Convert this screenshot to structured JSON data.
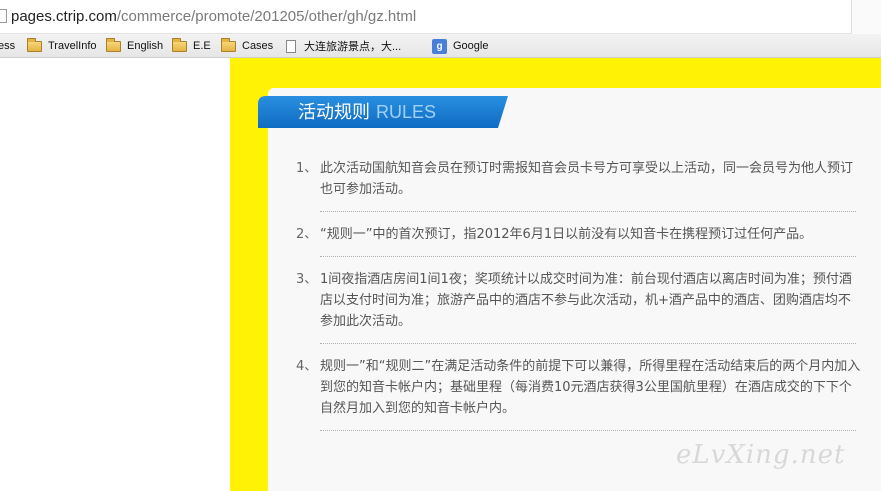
{
  "browser": {
    "url_host": "pages.ctrip.com",
    "url_path": "/commerce/promote/201205/other/gh/gz.html",
    "bookmarks": [
      {
        "label": "ess",
        "icon": "none"
      },
      {
        "label": "TravelInfo",
        "icon": "folder-icon"
      },
      {
        "label": "English",
        "icon": "folder-icon"
      },
      {
        "label": "E.E",
        "icon": "folder-icon"
      },
      {
        "label": "Cases",
        "icon": "folder-icon"
      },
      {
        "label": "大连旅游景点，大...",
        "icon": "page-icon"
      },
      {
        "label": "Google",
        "icon": "google-icon"
      }
    ],
    "google_letter": "g"
  },
  "colors": {
    "page_background": "#fff204",
    "panel": "#f8f8f8",
    "ribbon_blue": "#1379d1",
    "ribbon_light": "#9fd1f7"
  },
  "header": {
    "title_cn": "活动规则",
    "title_en": "RULES"
  },
  "rules": [
    {
      "num": "1、",
      "text": "此次活动国航知音会员在预订时需报知音会员卡号方可享受以上活动，同一会员号为他人预订也可参加活动。"
    },
    {
      "num": "2、",
      "text": "“规则一”中的首次预订，指2012年6月1日以前没有以知音卡在携程预订过任何产品。"
    },
    {
      "num": "3、",
      "text": "1间夜指酒店房间1间1夜；奖项统计以成交时间为准：前台现付酒店以离店时间为准；预付酒店以支付时间为准；旅游产品中的酒店不参与此次活动，机+酒产品中的酒店、团购酒店均不参加此次活动。"
    },
    {
      "num": "4、",
      "text": "规则一”和“规则二”在满足活动条件的前提下可以兼得，所得里程在活动结束后的两个月内加入到您的知音卡帐户内；基础里程（每消费10元酒店获得3公里国航里程）在酒店成交的下下个自然月加入到您的知音卡帐户内。"
    }
  ],
  "watermark": "eLvXing.net"
}
